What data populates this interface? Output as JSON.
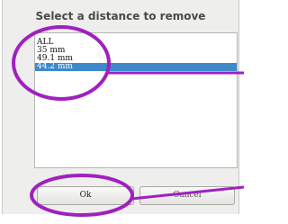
{
  "dialog": {
    "title": "Select a distance to remove",
    "options": [
      "ALL",
      "35 mm",
      "49.1 mm",
      "44.2 mm"
    ],
    "selected_index": 3,
    "ok_label": "Ok",
    "cancel_label": "Cancel"
  },
  "colors": {
    "selection": "#3d89cc",
    "annotation": "#a020c0",
    "dialog_background": "#eeeeec"
  }
}
